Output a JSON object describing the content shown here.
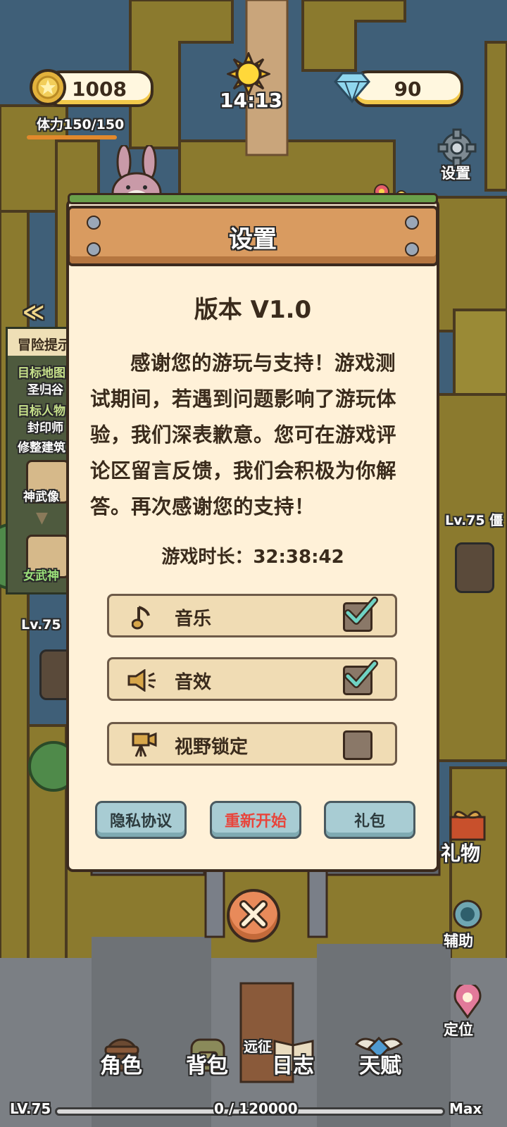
{
  "hud": {
    "coins": "1008",
    "gems": "90",
    "clock": "14:13",
    "stamina": "体力150/150",
    "settings_label": "设置"
  },
  "quest_panel": {
    "title": "冒险提示",
    "target_map_label": "目标地图",
    "target_map_value": "圣归谷",
    "target_npc_label": "目标人物",
    "target_npc_value": "封印师",
    "task_text": "修整建筑",
    "slot1": "神武像",
    "slot2": "女武神"
  },
  "world": {
    "enemy_right": "Lv.75 僵",
    "enemy_left": "Lv.75"
  },
  "modal": {
    "title": "设置",
    "version": "版本 V1.0",
    "message": "感谢您的游玩与支持！游戏测试期间，若遇到问题影响了游玩体验，我们深表歉意。您可在游戏评论区留言反馈，我们会积极为你解答。再次感谢您的支持！",
    "playtime": "游戏时长：32:38:42",
    "options": [
      {
        "label": "音乐",
        "icon": "music-note-icon",
        "checked": true
      },
      {
        "label": "音效",
        "icon": "speaker-icon",
        "checked": true
      },
      {
        "label": "视野锁定",
        "icon": "camera-icon",
        "checked": false
      }
    ],
    "buttons": {
      "privacy": "隐私协议",
      "restart": "重新开始",
      "gift": "礼包"
    }
  },
  "side_buttons": {
    "gift": "礼物",
    "assist": "辅助",
    "locate": "定位"
  },
  "bottom_nav": {
    "character": "角色",
    "backpack": "背包",
    "expedition": "远征",
    "log": "日志",
    "talent": "天赋"
  },
  "xp": {
    "level": "LV.75",
    "progress": "0 / 120000",
    "max": "Max",
    "fraction": 0
  },
  "colors": {
    "restart_text": "#e8453c",
    "check": "#6fd3c4",
    "plank": "#d99b60",
    "panel": "#fff1d8"
  }
}
